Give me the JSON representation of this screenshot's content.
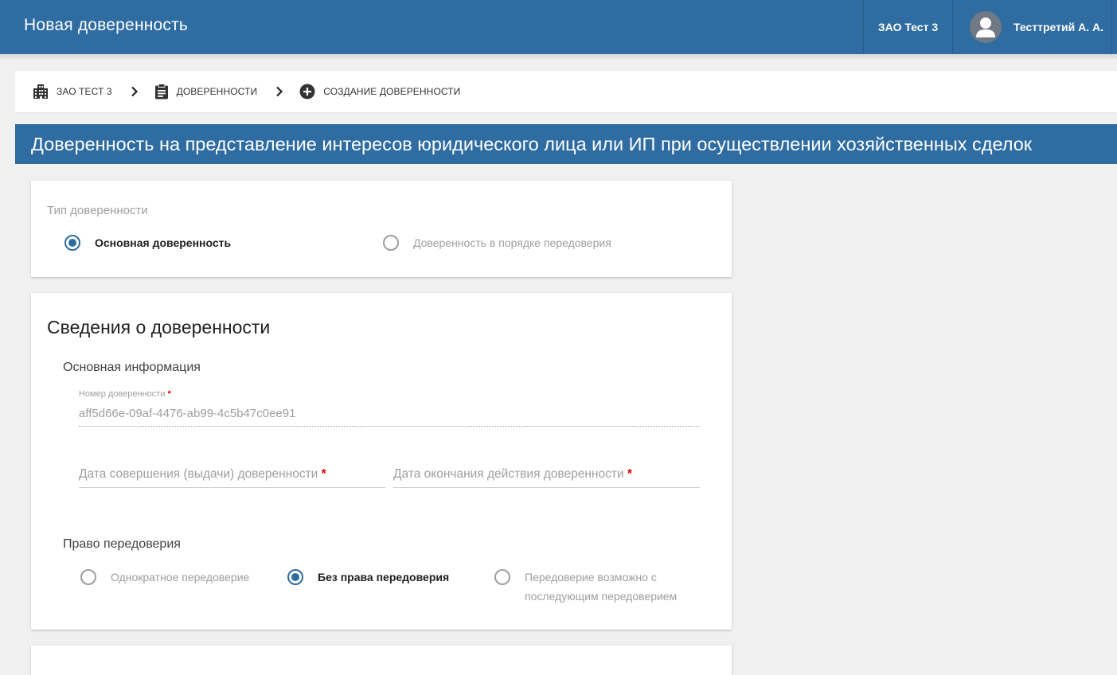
{
  "topbar": {
    "app_title": "Новая доверенность",
    "org_name": "ЗАО Тест 3",
    "user_name": "Тесттретий А. А.",
    "avatar_icon": "user-icon",
    "background_color": "#2e6ca1"
  },
  "breadcrumb": {
    "items": [
      {
        "label": "ЗАО Тест 3",
        "icon": "building-icon"
      },
      {
        "label": "Доверенности",
        "icon": "clipboard-icon"
      },
      {
        "label": "Создание доверенности",
        "icon": "add-circle-icon"
      }
    ],
    "separator_icon": "chevron-right-icon"
  },
  "page_title": "Доверенность на представление интересов юридического лица или ИП при осуществлении хозяйственных сделок",
  "type_card": {
    "label": "Тип доверенности",
    "options": [
      {
        "label": "Основная доверенность",
        "selected": true
      },
      {
        "label": "Доверенность в порядке передоверия",
        "selected": false
      }
    ]
  },
  "details_card": {
    "title": "Сведения о доверенности",
    "basic_info_title": "Основная информация",
    "number_field": {
      "label": "Номер доверенности",
      "required_mark": "*",
      "value": "aff5d66e-09af-4476-ab99-4c5b47c0ee91"
    },
    "issue_date_field": {
      "placeholder": "Дата совершения (выдачи) доверенности",
      "required_mark": "*",
      "value": ""
    },
    "end_date_field": {
      "placeholder": "Дата окончания действия доверенности",
      "required_mark": "*",
      "value": ""
    },
    "substitution_title": "Право передоверия",
    "substitution_options": [
      {
        "label": "Однократное передоверие",
        "selected": false
      },
      {
        "label": "Без права передоверия",
        "selected": true
      },
      {
        "label": "Передоверие возможно с последующим передоверием",
        "line1": "Передоверие возможно с",
        "line2": "последующим передоверием",
        "selected": false
      }
    ]
  },
  "accent_color": "#2e6ca1",
  "required_color": "#e00000"
}
